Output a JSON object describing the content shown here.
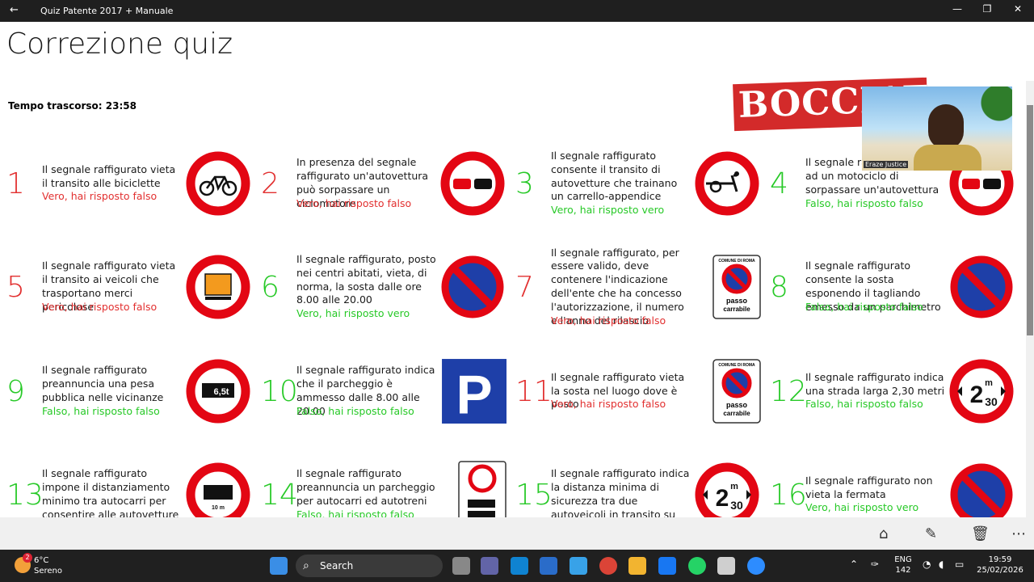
{
  "window": {
    "title": "Quiz Patente 2017 + Manuale",
    "back": "←",
    "minimize": "—",
    "maximize": "❐",
    "close": "✕"
  },
  "page": {
    "title": "Correzione quiz",
    "elapsed_label": "Tempo trascorso:",
    "elapsed_value": "23:58",
    "stamp": "BOCCIATO"
  },
  "video": {
    "name": "Eraze Justice"
  },
  "questions": [
    {
      "n": "1",
      "q": "Il segnale raffigurato vieta il transito alle biciclette",
      "r": "Vero, hai risposto falso",
      "ok": false,
      "sign": "no-bicycles"
    },
    {
      "n": "2",
      "q": "In presenza del segnale raffigurato un'autovettura può sorpassare un ciclomotore",
      "r": "Vero, hai risposto falso",
      "ok": false,
      "sign": "no-overtaking"
    },
    {
      "n": "3",
      "q": "Il segnale raffigurato consente il transito di autovetture che trainano un carrello-appendice",
      "r": "Vero, hai risposto vero",
      "ok": true,
      "sign": "no-handcarts"
    },
    {
      "n": "4",
      "q": "Il segnale raffigurato vieta ad un motociclo di sorpassare un'autovettura",
      "r": "Falso, hai risposto falso",
      "ok": true,
      "sign": "no-overtaking"
    },
    {
      "n": "5",
      "q": "Il segnale raffigurato vieta il transito ai veicoli che trasportano merci pericolose",
      "r": "Vero, hai risposto falso",
      "ok": false,
      "sign": "no-dangerous-goods"
    },
    {
      "n": "6",
      "q": "Il segnale raffigurato, posto nei centri abitati, vieta, di norma, la sosta dalle ore 8.00 alle 20.00",
      "r": "Vero, hai risposto vero",
      "ok": true,
      "sign": "no-parking"
    },
    {
      "n": "7",
      "q": "Il segnale raffigurato, per essere valido, deve contenere l'indicazione dell'ente che ha concesso l'autorizzazione, il numero e l'anno del rilascio",
      "r": "Vero, hai risposto falso",
      "ok": false,
      "sign": "passo-carrabile"
    },
    {
      "n": "8",
      "q": "Il segnale raffigurato consente la sosta esponendo il tagliando emesso da un parchimetro",
      "r": "Falso, hai risposto falso",
      "ok": true,
      "sign": "no-parking"
    },
    {
      "n": "9",
      "q": "Il segnale raffigurato preannuncia una pesa pubblica nelle vicinanze",
      "r": "Falso, hai risposto falso",
      "ok": true,
      "sign": "weight-limit"
    },
    {
      "n": "10",
      "q": "Il segnale raffigurato indica che il parcheggio è ammesso dalle 8.00 alle 20.00",
      "r": "Falso, hai risposto falso",
      "ok": true,
      "sign": "parking"
    },
    {
      "n": "11",
      "q": "Il segnale raffigurato vieta la sosta nel luogo dove è posto",
      "r": "Vero, hai risposto falso",
      "ok": false,
      "sign": "passo-carrabile"
    },
    {
      "n": "12",
      "q": "Il segnale raffigurato indica una strada larga 2,30 metri",
      "r": "Falso, hai risposto falso",
      "ok": true,
      "sign": "width-limit"
    },
    {
      "n": "13",
      "q": "Il segnale raffigurato impone il distanziamento minimo tra autocarri per consentire alle autovetture di sorpassarli",
      "r": "",
      "ok": true,
      "sign": "min-distance"
    },
    {
      "n": "14",
      "q": "Il segnale raffigurato preannuncia un parcheggio per autocarri ed autotreni",
      "r": "Falso, hai risposto falso",
      "ok": true,
      "sign": "truck-parking"
    },
    {
      "n": "15",
      "q": "Il segnale raffigurato indica la distanza minima di sicurezza tra due autoveicoli in transito su quella strada",
      "r": "",
      "ok": true,
      "sign": "width-limit"
    },
    {
      "n": "16",
      "q": "Il segnale raffigurato non vieta la fermata",
      "r": "Vero, hai risposto vero",
      "ok": true,
      "sign": "no-parking"
    }
  ],
  "sign_text": {
    "weight": "6,5t",
    "width_num": "2",
    "width_sup": "m",
    "width_dec": "30",
    "distance": "10 m",
    "comune": "COMUNE DI ROMA",
    "passo1": "passo",
    "passo2": "carrabile",
    "parking": "P"
  },
  "taskbar": {
    "temp": "6°C",
    "weather": "Sereno",
    "search": "Search",
    "lang1": "ENG",
    "lang2": "142",
    "time": "19:59",
    "date": "25/02/2026",
    "badge": "2"
  },
  "colors": {
    "wrong": "#e23030",
    "right": "#27c927",
    "sign_red": "#e30613",
    "sign_blue": "#1e3fa8"
  }
}
